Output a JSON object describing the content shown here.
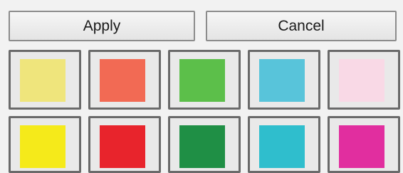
{
  "buttons": {
    "apply_label": "Apply",
    "cancel_label": "Cancel"
  },
  "colors": {
    "row1": [
      "#efe57c",
      "#f26a54",
      "#5cbf4a",
      "#58c4da",
      "#f9d9e6"
    ],
    "row2": [
      "#f5ea1a",
      "#e8242c",
      "#1f8f45",
      "#2fbecd",
      "#e12e9f"
    ]
  },
  "selected_swatch": "none"
}
